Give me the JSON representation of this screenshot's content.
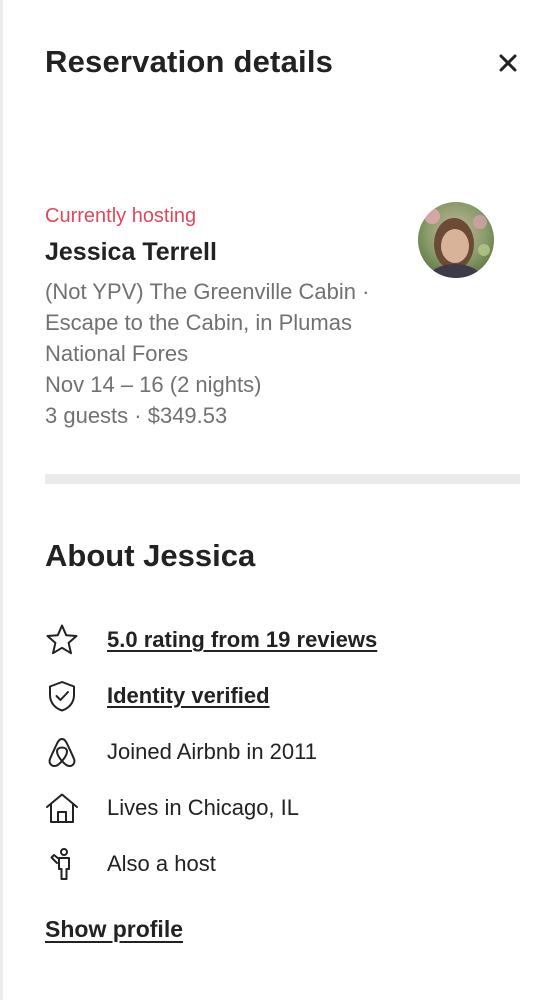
{
  "header": {
    "title": "Reservation details",
    "close_icon": "close-icon"
  },
  "reservation": {
    "status": "Currently hosting",
    "status_color": "#e0485a",
    "guest_name": "Jessica Terrell",
    "listing_line1": "(Not YPV) The Greenville Cabin ·",
    "listing_line2": "Escape to the Cabin, in Plumas",
    "listing_line3": "National Fores",
    "dates": "Nov 14 – 16 (2 nights)",
    "guests_price": "3 guests · $349.53"
  },
  "about": {
    "heading": "About Jessica",
    "facts": [
      {
        "icon": "star-icon",
        "text": "5.0 rating from 19 reviews",
        "link": true
      },
      {
        "icon": "shield-check-icon",
        "text": "Identity verified",
        "link": true
      },
      {
        "icon": "airbnb-logo-icon",
        "text": "Joined Airbnb in 2011",
        "link": false
      },
      {
        "icon": "house-icon",
        "text": "Lives in Chicago, IL",
        "link": false
      },
      {
        "icon": "host-icon",
        "text": "Also a host",
        "link": false
      }
    ],
    "show_profile": "Show profile"
  }
}
